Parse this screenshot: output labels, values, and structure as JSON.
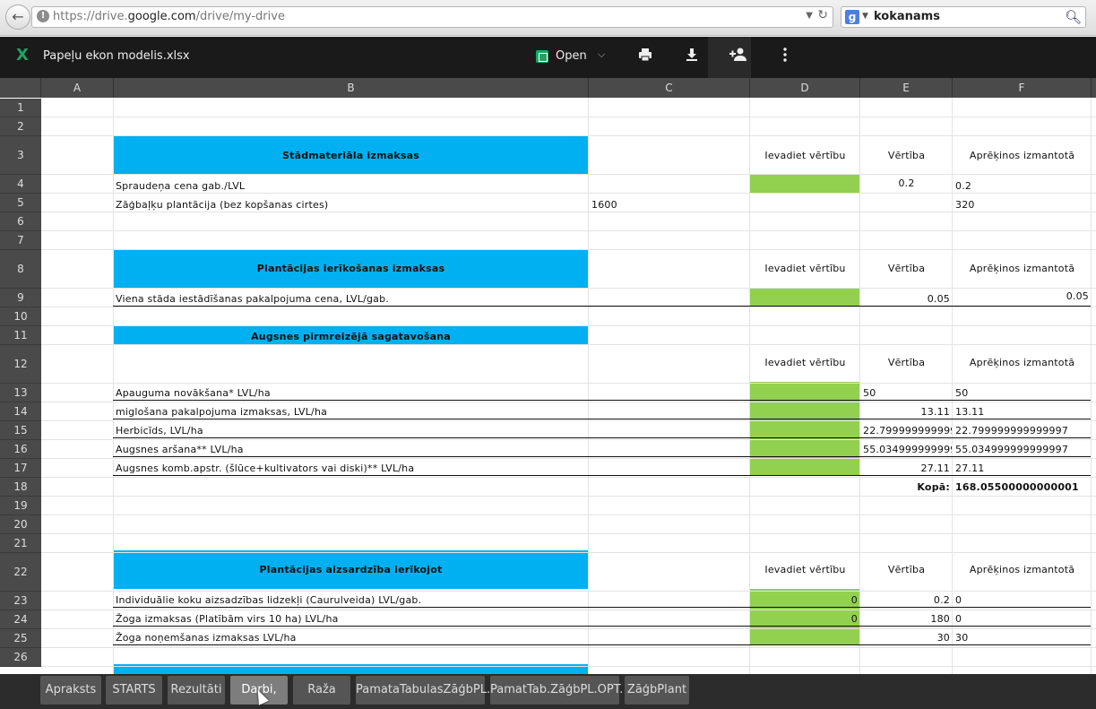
{
  "browser": {
    "url_prefix": "https://drive.",
    "url_domain": "google.com",
    "url_suffix": "/drive/my-drive",
    "search_query": "kokanams",
    "search_engine_label": "g",
    "icons": {
      "back": "arrow-left-icon",
      "warning": "info-circle-icon",
      "reload": "reload-icon",
      "search": "magnifier-icon"
    }
  },
  "app": {
    "file_title": "Papeļu ekon modelis.xlsx",
    "file_icon_glyph": "X",
    "open_label": "Open",
    "icons": {
      "print": "printer-icon",
      "download": "download-icon",
      "share": "add-person-icon",
      "more": "more-vert-icon"
    }
  },
  "columns": [
    "A",
    "B",
    "C",
    "D",
    "E",
    "F"
  ],
  "rows": [
    "1",
    "2",
    "3",
    "4",
    "5",
    "6",
    "7",
    "8",
    "9",
    "10",
    "11",
    "12",
    "13",
    "14",
    "15",
    "16",
    "17",
    "18",
    "19",
    "20",
    "21",
    "22",
    "23",
    "24",
    "25",
    "26"
  ],
  "section_titles": {
    "r3": "Stādmateriāla izmaksas",
    "r8": "Plantācijas ierīkošanas izmaksas",
    "r11": "Augsnes pirmreizējā sagatavošana",
    "r22": "Plantācijas aizsardzība ierīkojot"
  },
  "headers": {
    "ievadiet": "Ievadiet vērtību",
    "vertiba": "Vērtība",
    "aprekinos": "Aprēķinos izmantotā"
  },
  "cells": {
    "b4": "Spraudeņa cena gab./LVL",
    "e4": "0.2",
    "f4": "0.2",
    "b5": "Zāģbaļķu plantācija (bez kopšanas cirtes)",
    "c5": "1600",
    "f5": "320",
    "b9": "Viena stāda iestādīšanas pakalpojuma cena, LVL/gab.",
    "e9": "0.05",
    "f9": "0.05",
    "b13": "Apauguma novākšana* LVL/ha",
    "e13": "50",
    "f13": "50",
    "b14": "miglošana pakalpojuma izmaksas, LVL/ha",
    "e14": "13.11",
    "f14": "13.11",
    "b15": "Herbicīds, LVL/ha",
    "e15": "22.7999999999999",
    "f15": "22.799999999999997",
    "b16": "Augsnes aršana** LVL/ha",
    "e16": "55.0349999999999",
    "f16": "55.034999999999997",
    "b17": "Augsnes komb.apstr. (šlūce+kultivators vai diski)** LVL/ha",
    "e17": "27.11",
    "f17": "27.11",
    "e18": "Kopā:",
    "f18": "168.05500000000001",
    "b23": "Individuālie koku aizsadzības lidzekļi (Caurulveida) LVL/gab.",
    "d23": "0",
    "e23": "0.2",
    "f23": "0",
    "b24": "Žoga izmaksas (Platībām virs 10 ha) LVL/ha",
    "d24": "0",
    "e24": "180",
    "f24": "0",
    "b25": "Žoga noņemšanas izmaksas LVL/ha",
    "e25": "30",
    "f25": "30"
  },
  "sheet_tabs": [
    "Apraksts",
    "STARTS",
    "Rezultāti",
    "Darbi,",
    "Raža",
    "PamataTabulasZāģbPL.",
    "PamatTab.ZāģbPL.OPT.",
    "ZāģbPlant"
  ],
  "active_tab": "Darbi,",
  "colors": {
    "section_fill": "#00b0f0",
    "input_fill": "#92d050",
    "header_bg": "#4a4a4a",
    "app_bar": "#1a1a1a"
  }
}
